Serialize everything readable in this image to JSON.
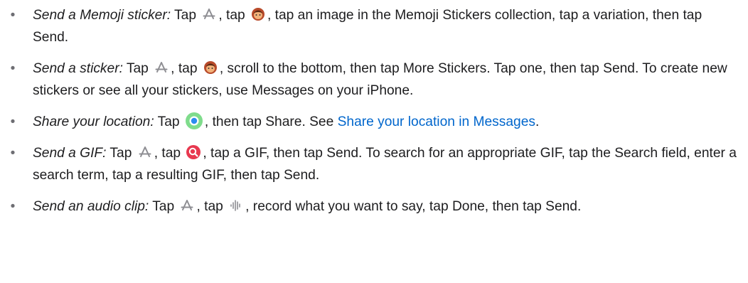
{
  "items": [
    {
      "lead": "Send a Memoji sticker:",
      "p1": " Tap ",
      "icon1": "app-store-icon",
      "p2": ", tap ",
      "icon2": "memoji-icon",
      "p3": ", tap an image in the Memoji Stickers collection, tap a variation, then tap Send."
    },
    {
      "lead": "Send a sticker:",
      "p1": " Tap ",
      "icon1": "app-store-icon",
      "p2": ", tap ",
      "icon2": "memoji-icon",
      "p3": ", scroll to the bottom, then tap More Stickers. Tap one, then tap Send. To create new stickers or see all your stickers, use Messages on your iPhone."
    },
    {
      "lead": "Share your location:",
      "p1": " Tap ",
      "icon1": "location-icon",
      "p2": ", then tap Share. See ",
      "link": "Share your location in Messages",
      "p3": "."
    },
    {
      "lead": "Send a GIF:",
      "p1": " Tap ",
      "icon1": "app-store-icon",
      "p2": ", tap ",
      "icon2": "gif-search-icon",
      "p3": ", tap a GIF, then tap Send. To search for an appropriate GIF, tap the Search field, enter a search term, tap a resulting GIF, then tap Send."
    },
    {
      "lead": "Send an audio clip:",
      "p1": " Tap ",
      "icon1": "app-store-icon",
      "p2": ", tap ",
      "icon2": "waveform-icon",
      "p3": ", record what you want to say, tap Done, then tap Send."
    }
  ],
  "bullet": "•",
  "colors": {
    "text": "#1d1d1f",
    "link": "#0066cc",
    "bullet": "#6e6e73"
  }
}
